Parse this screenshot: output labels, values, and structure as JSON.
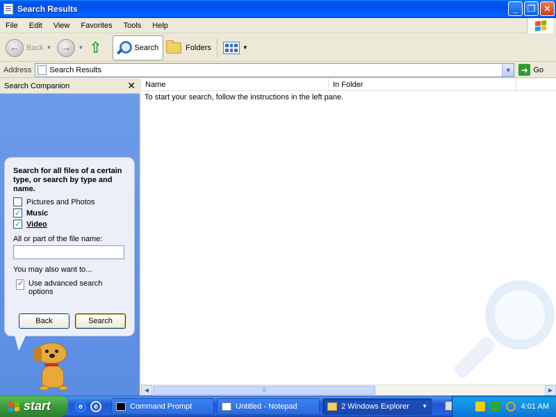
{
  "window": {
    "title": "Search Results",
    "controls": [
      "minimize",
      "restore",
      "close"
    ]
  },
  "menubar": {
    "items": [
      "File",
      "Edit",
      "View",
      "Favorites",
      "Tools",
      "Help"
    ]
  },
  "toolbar": {
    "back_label": "Back",
    "search_label": "Search",
    "folders_label": "Folders"
  },
  "address": {
    "label": "Address",
    "value": "Search Results",
    "go_label": "Go"
  },
  "search_companion": {
    "header": "Search Companion",
    "question": "Search for all files of a certain type, or search by type and name.",
    "options": [
      {
        "label": "Pictures and Photos",
        "checked": false
      },
      {
        "label": "Music",
        "checked": true
      },
      {
        "label": "Video",
        "checked": true
      }
    ],
    "filename_label": "All or part of the file name:",
    "filename_value": "",
    "also_label": "You may also want to...",
    "advanced_label": "Use advanced search options",
    "back_button": "Back",
    "search_button": "Search"
  },
  "results": {
    "columns": [
      "Name",
      "In Folder"
    ],
    "hint": "To start your search, follow the instructions in the left pane."
  },
  "taskbar": {
    "start_label": "start",
    "tasks": [
      {
        "label": "Command Prompt",
        "active": false
      },
      {
        "label": "Untitled - Notepad",
        "active": false
      },
      {
        "label": "2 Windows Explorer",
        "active": true
      }
    ],
    "clock": "4:01 AM"
  },
  "colors": {
    "titlebar": "#0053EE",
    "companion_bg": "#5A8DE3",
    "start_green": "#3C9A3C",
    "taskbar_blue": "#2157D7"
  }
}
